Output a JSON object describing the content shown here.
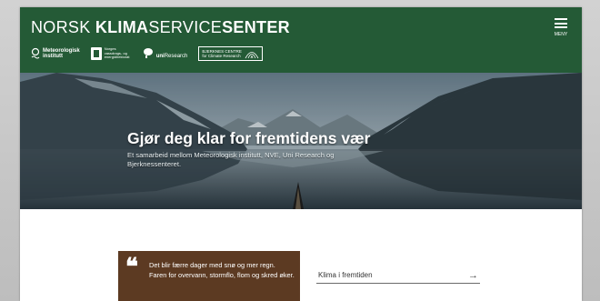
{
  "header": {
    "title_light": "NORSK ",
    "title_bold": "KLIMA",
    "title_light2": "SERVICE",
    "title_bold2": "SENTER",
    "menu_label": "MENY",
    "partners": [
      {
        "name": "Meteorologisk institutt",
        "line1": "Meteorologisk",
        "line2": "institutt"
      },
      {
        "name": "NVE",
        "line1": "Norges",
        "line2": "vassdrags- og energidirektorat"
      },
      {
        "name": "Uni Research",
        "line1": "uni",
        "line2": "Research"
      },
      {
        "name": "Bjerknes Centre",
        "line1": "BJERKNES CENTRE",
        "line2": "for Climate Research"
      }
    ]
  },
  "hero": {
    "title": "Gjør deg klar for fremtidens vær",
    "subtitle": "Et samarbeid mellom Meteorologisk institutt, NVE, Uni Research og Bjerknessenteret."
  },
  "quote": {
    "mark": "❝",
    "text": "Det blir færre dager med snø og mer regn. Faren for overvann, stormflo, flom og skred øker."
  },
  "link": {
    "label": "Klima i fremtiden",
    "arrow": "→"
  },
  "colors": {
    "header_green": "#245a36",
    "quote_brown": "#5c3a22"
  }
}
